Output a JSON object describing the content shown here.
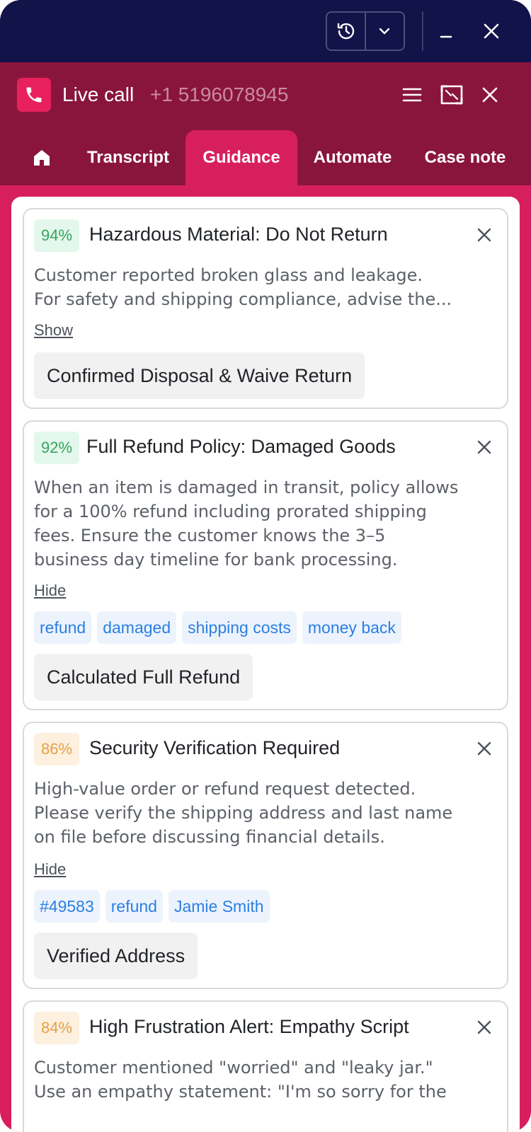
{
  "topbar": {
    "icons": [
      "history-icon",
      "chevron-down-icon",
      "minimize-icon",
      "close-icon"
    ]
  },
  "call": {
    "title": "Live call",
    "number": "+1 5196078945",
    "icons": [
      "phone-icon",
      "menu-icon",
      "expand-icon",
      "close-icon"
    ]
  },
  "tabs": {
    "home_icon": "home-icon",
    "items": [
      {
        "label": "Transcript"
      },
      {
        "label": "Guidance",
        "active": true
      },
      {
        "label": "Automate"
      },
      {
        "label": "Case note"
      }
    ]
  },
  "colors": {
    "topbar": "#121349",
    "header": "#8a153c",
    "accent": "#d81f5e",
    "chip_text": "#2b7fe3",
    "badge_green": "#36a55b",
    "badge_orange": "#e6a046"
  },
  "cards": [
    {
      "score": "94%",
      "title": "Hazardous Material: Do Not Return",
      "description": "Customer reported broken glass and leakage. For safety and shipping compliance, advise the...",
      "desc_line1": "Customer reported broken glass and leakage.",
      "desc_line2": "For safety and shipping compliance, advise the...",
      "toggle": "Show",
      "action": "Confirmed Disposal & Waive Return"
    },
    {
      "score": "92%",
      "title": "Full Refund Policy: Damaged Goods",
      "desc_lines": [
        "When an item is damaged in transit, policy allows",
        "for a 100% refund including prorated shipping",
        "fees. Ensure the customer knows the 3–5",
        "business day timeline for bank processing."
      ],
      "toggle": "Hide",
      "tags": [
        "refund",
        "damaged",
        "shipping costs",
        "money back"
      ],
      "action": "Calculated Full Refund"
    },
    {
      "score": "86%",
      "title": "Security Verification Required",
      "desc_lines": [
        "High-value order or refund request detected.",
        "Please verify the shipping address and last name",
        "on file before discussing financial details."
      ],
      "toggle": "Hide",
      "tags": [
        "#49583",
        "refund",
        "Jamie Smith"
      ],
      "action": "Verified Address"
    },
    {
      "score": "84%",
      "title": "High Frustration Alert: Empathy Script",
      "desc_lines": [
        "Customer mentioned \"worried\" and \"leaky jar.\"",
        "Use an empathy statement: \"I'm so sorry for the"
      ]
    }
  ]
}
